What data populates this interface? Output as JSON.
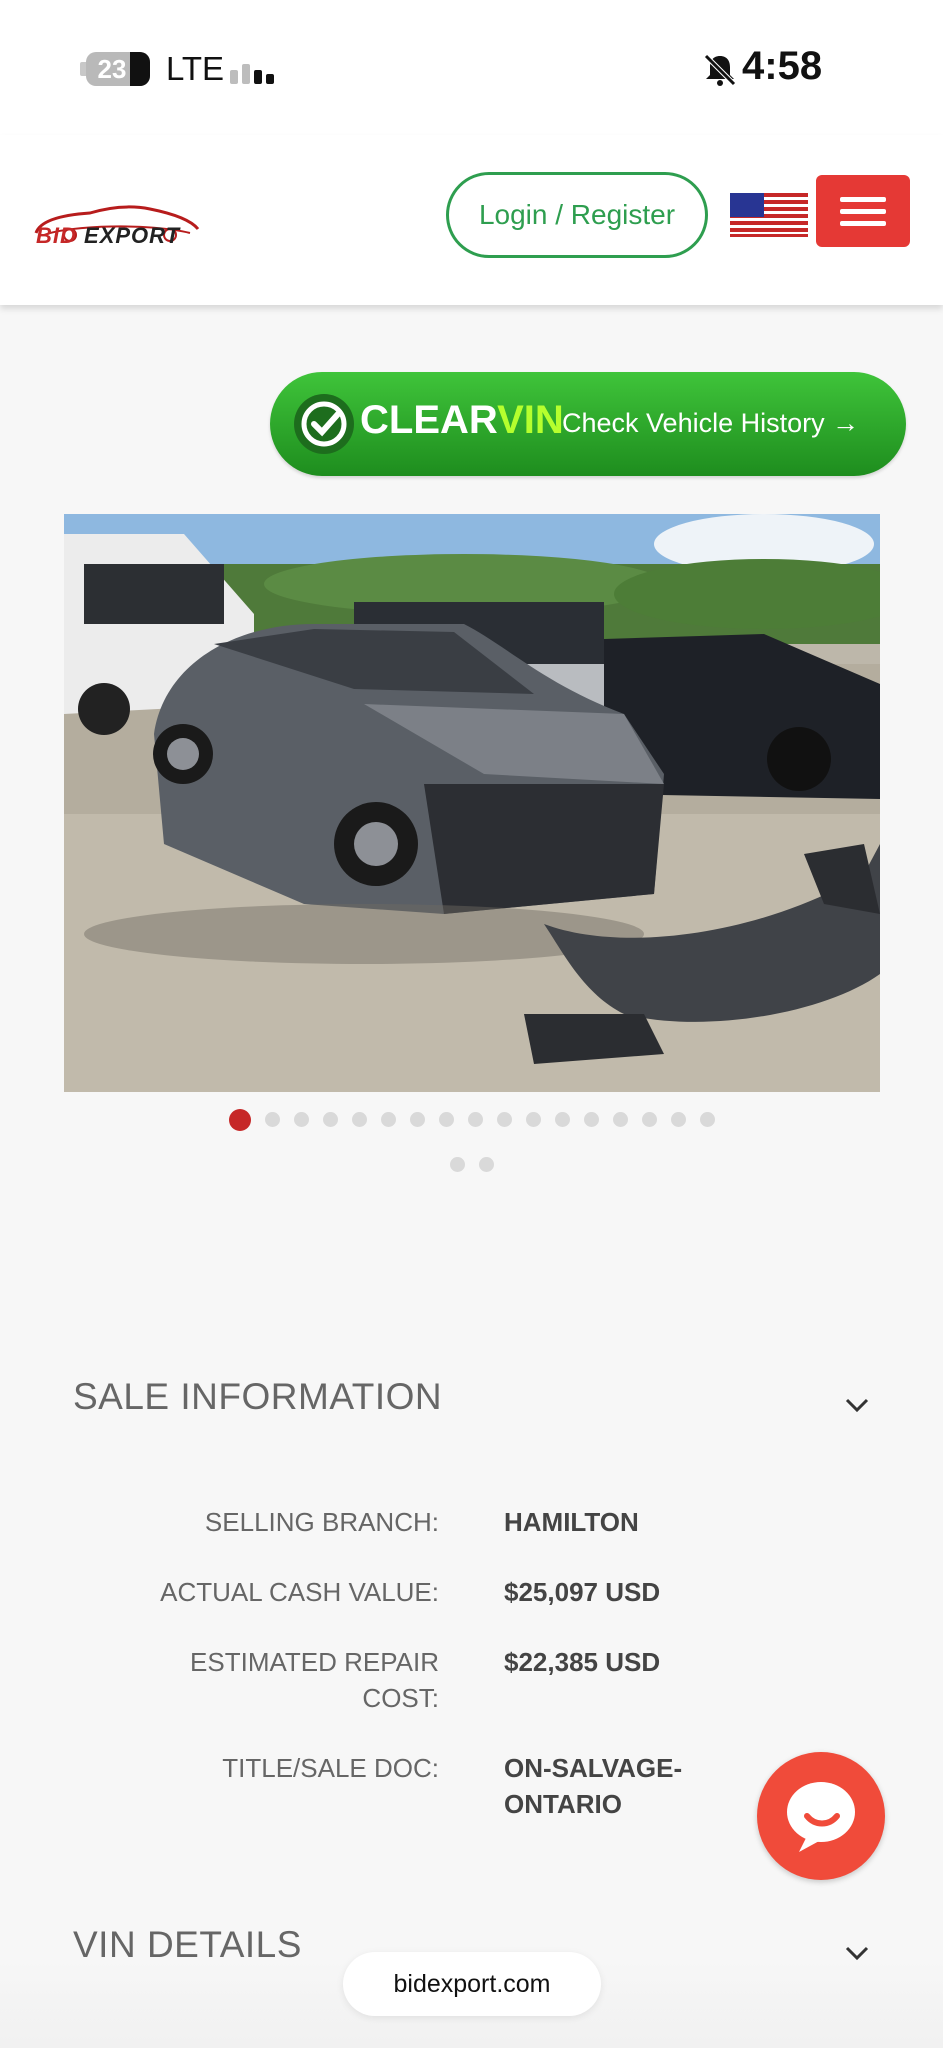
{
  "status_bar": {
    "battery_level": "23",
    "network": "LTE",
    "time": "4:58",
    "icons": [
      "battery-icon",
      "signal-icon",
      "bell-muted-icon"
    ]
  },
  "header": {
    "logo_text_1": "BID",
    "logo_text_2": "EXPORT",
    "login_label": "Login / Register",
    "flag": "us-flag-icon",
    "menu": "hamburger-menu-icon",
    "colors": {
      "login_green": "#2e9e4f",
      "menu_red": "#e53935"
    }
  },
  "clearvin": {
    "brand_clear": "CLEAR",
    "brand_vin": "VIN",
    "cta": "Check Vehicle History →",
    "colors": {
      "green": "#2ea82a",
      "vin_lime": "#b6ff2e"
    }
  },
  "gallery": {
    "total_images": 19,
    "active_index": 0
  },
  "sale_information": {
    "title": "SALE INFORMATION",
    "rows": [
      {
        "label": "SELLING BRANCH:",
        "value": "HAMILTON"
      },
      {
        "label": "ACTUAL CASH VALUE:",
        "value": "$25,097 USD"
      },
      {
        "label": "ESTIMATED REPAIR COST:",
        "value": "$22,385 USD"
      },
      {
        "label": "TITLE/SALE DOC:",
        "value": "ON-SALVAGE-ONTARIO"
      }
    ]
  },
  "vin_details": {
    "title": "VIN DETAILS"
  },
  "browser": {
    "url": "bidexport.com"
  }
}
